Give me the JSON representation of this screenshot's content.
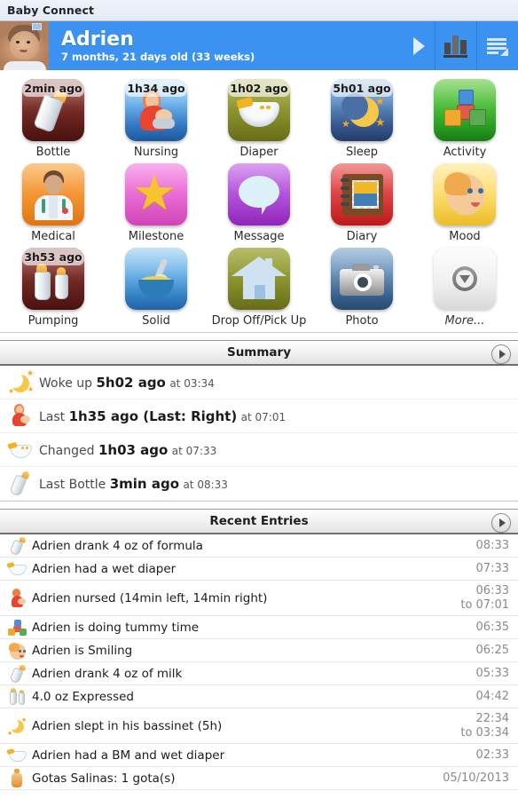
{
  "window": {
    "title": "Baby Connect"
  },
  "header": {
    "baby_name": "Adrien",
    "baby_age": "7 months, 21 days old (33 weeks)",
    "avatar_name": "baby-photo",
    "forward_arrow": "next-baby-arrow",
    "chart_button": "chart-icon",
    "list_button": "list-icon",
    "accent_color": "#3b92f0"
  },
  "tiles": [
    {
      "label": "Bottle",
      "badge": "2min ago",
      "icon": "baby-bottle-icon",
      "color": "#5a1a16"
    },
    {
      "label": "Nursing",
      "badge": "1h34 ago",
      "icon": "nursing-mother-icon",
      "color": "#2f78c8"
    },
    {
      "label": "Diaper",
      "badge": "1h02 ago",
      "icon": "diaper-icon",
      "color": "#8d9426"
    },
    {
      "label": "Sleep",
      "badge": "5h01 ago",
      "icon": "crescent-moon-icon",
      "color": "#33558f"
    },
    {
      "label": "Activity",
      "badge": "",
      "icon": "building-blocks-icon",
      "color": "#25a31c"
    },
    {
      "label": "Medical",
      "badge": "",
      "icon": "doctor-icon",
      "color": "#f59530"
    },
    {
      "label": "Milestone",
      "badge": "",
      "icon": "star-icon",
      "color": "#ec6bd6"
    },
    {
      "label": "Message",
      "badge": "",
      "icon": "speech-bubble-icon",
      "color": "#b14ddc"
    },
    {
      "label": "Diary",
      "badge": "",
      "icon": "notebook-icon",
      "color": "#de3c3c"
    },
    {
      "label": "Mood",
      "badge": "",
      "icon": "baby-face-icon",
      "color": "#f8c92c"
    },
    {
      "label": "Pumping",
      "badge": "3h53 ago",
      "icon": "two-bottles-icon",
      "color": "#5a1a16"
    },
    {
      "label": "Solid",
      "badge": "",
      "icon": "bowl-spoon-icon",
      "color": "#2e7fcb"
    },
    {
      "label": "Drop Off/Pick Up",
      "badge": "",
      "icon": "house-icon",
      "color": "#8d9426"
    },
    {
      "label": "Photo",
      "badge": "",
      "icon": "camera-icon",
      "color": "#335f8f"
    },
    {
      "label": "More...",
      "badge": "",
      "icon": "chevron-down-circle-icon",
      "color": "#f0f0f0"
    }
  ],
  "summary": {
    "title": "Summary",
    "go_label": "go-to-summary",
    "rows": [
      {
        "icon": "crescent-moon-icon",
        "prefix": "Woke up",
        "value": "5h02 ago",
        "at": "at 03:34"
      },
      {
        "icon": "nursing-mother-icon",
        "prefix": "Last",
        "value": "1h35 ago (Last: Right)",
        "at": "at 07:01"
      },
      {
        "icon": "diaper-icon",
        "prefix": "Changed",
        "value": "1h03 ago",
        "at": "at 07:33"
      },
      {
        "icon": "baby-bottle-icon",
        "prefix": "Last Bottle",
        "value": "3min ago",
        "at": "at 08:33"
      }
    ]
  },
  "recent": {
    "title": "Recent Entries",
    "go_label": "go-to-recent-entries",
    "rows": [
      {
        "icon": "baby-bottle-icon",
        "text": "Adrien drank 4 oz of formula",
        "time": "08:33",
        "time2": ""
      },
      {
        "icon": "diaper-icon",
        "text": "Adrien had a wet diaper",
        "time": "07:33",
        "time2": ""
      },
      {
        "icon": "nursing-mother-icon",
        "text": "Adrien nursed (14min left, 14min right)",
        "time": "06:33",
        "time2": "to 07:01"
      },
      {
        "icon": "building-blocks-icon",
        "text": "Adrien is doing tummy time",
        "time": "06:35",
        "time2": ""
      },
      {
        "icon": "baby-face-icon",
        "text": "Adrien is Smiling",
        "time": "06:25",
        "time2": ""
      },
      {
        "icon": "baby-bottle-icon",
        "text": "Adrien drank 4 oz of milk",
        "time": "05:33",
        "time2": ""
      },
      {
        "icon": "two-bottles-icon",
        "text": "4.0 oz Expressed",
        "time": "04:42",
        "time2": ""
      },
      {
        "icon": "crescent-moon-icon",
        "text": "Adrien slept in his bassinet (5h)",
        "time": "22:34",
        "time2": "to 03:34"
      },
      {
        "icon": "diaper-icon",
        "text": "Adrien had a BM and wet diaper",
        "time": "02:33",
        "time2": ""
      },
      {
        "icon": "medicine-bottle-icon",
        "text": "Gotas Salinas: 1 gota(s)",
        "time": "05/10/2013",
        "time2": ""
      }
    ]
  }
}
